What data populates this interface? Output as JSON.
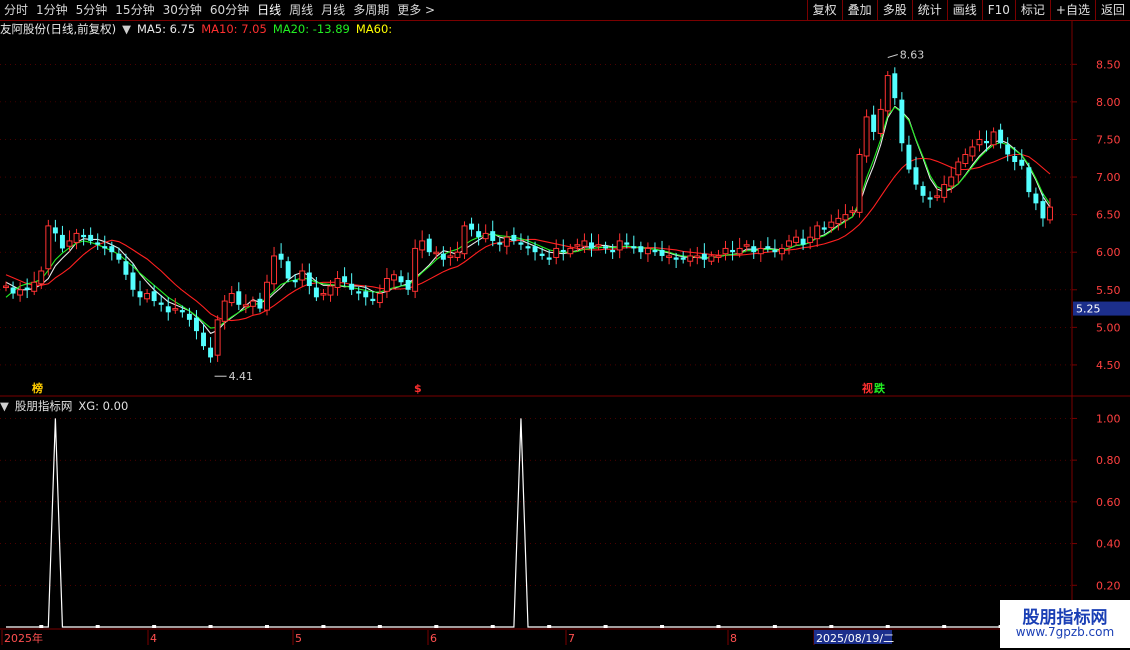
{
  "toolbar": {
    "periods": [
      "分时",
      "1分钟",
      "5分钟",
      "15分钟",
      "30分钟",
      "60分钟",
      "日线",
      "周线",
      "月线",
      "多周期",
      "更多 >"
    ],
    "active_period": "日线",
    "buttons": [
      "复权",
      "叠加",
      "多股",
      "统计",
      "画线",
      "F10",
      "标记",
      "+自选",
      "返回"
    ]
  },
  "main_header": {
    "title": "友阿股份(日线,前复权)",
    "ma5": "MA5: 6.75",
    "ma10": "MA10: 7.05",
    "ma20": "MA20: -13.89",
    "ma60": "MA60:"
  },
  "sub_header": {
    "title": "股朋指标网",
    "xg": "XG: 0.00"
  },
  "colors": {
    "up": "#ff3232",
    "down": "#54ffff",
    "ma5": "#e8e8e8",
    "ma10": "#ff2020",
    "ma20": "#22ee22",
    "ma60": "#ffff00",
    "grid": "#7a0000"
  },
  "chart_data": [
    {
      "type": "candlestick",
      "title": "友阿股份(日线,前复权)",
      "y_ticks": [
        "8.50",
        "8.00",
        "7.50",
        "7.00",
        "6.50",
        "6.00",
        "5.50",
        "5.00",
        "4.50"
      ],
      "ylim": [
        4.1,
        8.85
      ],
      "current_price": "5.25",
      "annotations": {
        "high": "8.63",
        "low": "4.41"
      },
      "markers": [
        "榜",
        "$",
        "视",
        "跌"
      ],
      "close": [
        5.55,
        5.45,
        5.5,
        5.5,
        5.6,
        5.75,
        6.35,
        6.25,
        6.05,
        6.15,
        6.25,
        6.2,
        6.15,
        6.1,
        6.05,
        6.0,
        5.9,
        5.7,
        5.5,
        5.4,
        5.45,
        5.35,
        5.3,
        5.2,
        5.25,
        5.2,
        5.1,
        4.95,
        4.75,
        4.6,
        5.1,
        5.35,
        5.45,
        5.3,
        5.3,
        5.35,
        5.25,
        5.6,
        5.95,
        5.9,
        5.65,
        5.6,
        5.75,
        5.55,
        5.4,
        5.45,
        5.55,
        5.65,
        5.6,
        5.5,
        5.45,
        5.4,
        5.35,
        5.45,
        5.65,
        5.7,
        5.6,
        5.5,
        6.05,
        6.15,
        6.0,
        6.0,
        5.9,
        5.95,
        6.0,
        6.35,
        6.3,
        6.2,
        6.25,
        6.15,
        6.1,
        6.2,
        6.15,
        6.1,
        6.05,
        6.0,
        5.95,
        5.9,
        6.05,
        6.0,
        6.05,
        6.1,
        6.15,
        6.05,
        6.1,
        6.05,
        6.0,
        6.15,
        6.1,
        6.05,
        6.0,
        6.05,
        6.0,
        5.95,
        5.95,
        5.9,
        5.9,
        5.95,
        5.95,
        5.9,
        5.95,
        5.95,
        6.05,
        6.0,
        6.05,
        6.1,
        6.0,
        6.05,
        6.05,
        6.0,
        6.05,
        6.15,
        6.2,
        6.1,
        6.2,
        6.35,
        6.3,
        6.4,
        6.45,
        6.5,
        6.55,
        7.3,
        7.8,
        7.6,
        7.9,
        8.35,
        8.05,
        7.45,
        7.1,
        6.9,
        6.75,
        6.7,
        6.75,
        6.9,
        7.0,
        7.2,
        7.3,
        7.4,
        7.5,
        7.45,
        7.6,
        7.45,
        7.3,
        7.2,
        7.15,
        6.8,
        6.65,
        6.45,
        6.6
      ],
      "series": [
        {
          "name": "MA5",
          "values": [
            5.6,
            5.55,
            5.5,
            5.5,
            5.52,
            5.57,
            5.65,
            5.82,
            5.92,
            6.01,
            6.13,
            6.18,
            6.17,
            6.17,
            6.14,
            6.1,
            6.05,
            5.95,
            5.85,
            5.71,
            5.6,
            5.5,
            5.42,
            5.34,
            5.3,
            5.26,
            5.22,
            5.14,
            5.04,
            4.92,
            4.96,
            5.06,
            5.13,
            5.2,
            5.29,
            5.37,
            5.33,
            5.36,
            5.45,
            5.53,
            5.63,
            5.7,
            5.73,
            5.69,
            5.61,
            5.56,
            5.56,
            5.56,
            5.54,
            5.55,
            5.55,
            5.53,
            5.48,
            5.45,
            5.48,
            5.52,
            5.55,
            5.58,
            5.66,
            5.74,
            5.83,
            5.94,
            6.02,
            6.0,
            5.97,
            6.04,
            6.1,
            6.16,
            6.22,
            6.25,
            6.2,
            6.18,
            6.16,
            6.16,
            6.12,
            6.08,
            6.04,
            6.0,
            5.99,
            5.98,
            6.0,
            6.02,
            6.07,
            6.07,
            6.09,
            6.09,
            6.07,
            6.07,
            6.08,
            6.07,
            6.06,
            6.05,
            6.04,
            6.01,
            5.99,
            5.96,
            5.94,
            5.93,
            5.93,
            5.92,
            5.93,
            5.94,
            5.96,
            5.97,
            5.99,
            6.04,
            6.04,
            6.04,
            6.05,
            6.04,
            6.03,
            6.05,
            6.09,
            6.1,
            6.13,
            6.2,
            6.23,
            6.29,
            6.36,
            6.42,
            6.47,
            6.64,
            6.92,
            7.15,
            7.43,
            7.79,
            7.94,
            7.87,
            7.77,
            7.49,
            7.25,
            6.98,
            6.84,
            6.81,
            6.84,
            6.91,
            7.03,
            7.16,
            7.28,
            7.37,
            7.46,
            7.49,
            7.45,
            7.37,
            7.29,
            7.14,
            6.96,
            6.74,
            6.6
          ]
        },
        {
          "name": "MA10",
          "values": [
            5.7,
            5.66,
            5.62,
            5.58,
            5.56,
            5.56,
            5.58,
            5.66,
            5.72,
            5.79,
            5.88,
            5.97,
            6.04,
            6.1,
            6.13,
            6.16,
            6.14,
            6.09,
            6.03,
            5.97,
            5.91,
            5.83,
            5.75,
            5.66,
            5.57,
            5.49,
            5.42,
            5.35,
            5.27,
            5.18,
            5.13,
            5.1,
            5.09,
            5.1,
            5.12,
            5.16,
            5.18,
            5.23,
            5.29,
            5.36,
            5.43,
            5.49,
            5.54,
            5.58,
            5.59,
            5.6,
            5.6,
            5.6,
            5.59,
            5.57,
            5.56,
            5.55,
            5.54,
            5.52,
            5.51,
            5.51,
            5.51,
            5.52,
            5.55,
            5.59,
            5.64,
            5.69,
            5.74,
            5.78,
            5.81,
            5.87,
            5.94,
            6.01,
            6.07,
            6.11,
            6.13,
            6.14,
            6.15,
            6.16,
            6.17,
            6.17,
            6.15,
            6.13,
            6.11,
            6.09,
            6.07,
            6.05,
            6.04,
            6.03,
            6.03,
            6.04,
            6.04,
            6.05,
            6.06,
            6.06,
            6.06,
            6.06,
            6.06,
            6.05,
            6.04,
            6.03,
            6.01,
            6.0,
            5.99,
            5.98,
            5.97,
            5.96,
            5.96,
            5.96,
            5.96,
            5.97,
            5.98,
            5.99,
            6.0,
            6.01,
            6.02,
            6.03,
            6.04,
            6.06,
            6.07,
            6.09,
            6.11,
            6.14,
            6.17,
            6.22,
            6.29,
            6.37,
            6.48,
            6.6,
            6.74,
            6.88,
            7.01,
            7.12,
            7.2,
            7.24,
            7.25,
            7.24,
            7.21,
            7.17,
            7.13,
            7.1,
            7.1,
            7.11,
            7.13,
            7.17,
            7.2,
            7.24,
            7.28,
            7.3,
            7.3,
            7.27,
            7.2,
            7.12,
            7.04
          ]
        },
        {
          "name": "MA20",
          "values": [
            5.4,
            5.48,
            5.55,
            5.58,
            5.6,
            5.64,
            5.76,
            5.9,
            5.99,
            6.06,
            6.12,
            6.15,
            6.13,
            6.1,
            6.06,
            6.02,
            5.97,
            5.89,
            5.81,
            5.72,
            5.64,
            5.56,
            5.48,
            5.4,
            5.34,
            5.28,
            5.22,
            5.15,
            5.07,
            4.99,
            5.0,
            5.07,
            5.14,
            5.2,
            5.25,
            5.3,
            5.32,
            5.39,
            5.48,
            5.57,
            5.61,
            5.63,
            5.66,
            5.64,
            5.6,
            5.58,
            5.57,
            5.56,
            5.55,
            5.53,
            5.51,
            5.49,
            5.47,
            5.47,
            5.5,
            5.53,
            5.55,
            5.56,
            5.64,
            5.73,
            5.81,
            5.9,
            5.97,
            6.01,
            6.04,
            6.1,
            6.16,
            6.2,
            6.23,
            6.24,
            6.22,
            6.21,
            6.2,
            6.18,
            6.15,
            6.11,
            6.07,
            6.03,
            6.01,
            6.0,
            6.0,
            6.01,
            6.04,
            6.05,
            6.06,
            6.07,
            6.06,
            6.07,
            6.08,
            6.07,
            6.06,
            6.05,
            6.04,
            6.02,
            6.0,
            5.97,
            5.95,
            5.94,
            5.94,
            5.93,
            5.93,
            5.94,
            5.96,
            5.97,
            5.98,
            6.02,
            6.02,
            6.03,
            6.04,
            6.03,
            6.03,
            6.05,
            6.09,
            6.1,
            6.13,
            6.19,
            6.22,
            6.28,
            6.35,
            6.41,
            6.47,
            6.68,
            6.99,
            7.23,
            7.5,
            7.82,
            7.93,
            7.86,
            7.75,
            7.5,
            7.27,
            7.02,
            6.87,
            6.83,
            6.85,
            6.91,
            7.02,
            7.14,
            7.26,
            7.35,
            7.43,
            7.46,
            7.43,
            7.36,
            7.29,
            7.16,
            6.98,
            6.78,
            6.64
          ]
        }
      ]
    },
    {
      "type": "line",
      "title": "股朋指标网",
      "series": [
        {
          "name": "XG",
          "peaks": [
            7,
            73
          ]
        }
      ],
      "y_ticks": [
        "1.00",
        "0.80",
        "0.60",
        "0.40",
        "0.20"
      ],
      "ylim": [
        0,
        1.05
      ],
      "x_ticks": [
        "2025年",
        "4",
        "5",
        "6",
        "7",
        "8",
        "2025/08/19/二"
      ]
    }
  ],
  "watermark": {
    "title": "股朋指标网",
    "url": "www.7gpzb.com"
  }
}
